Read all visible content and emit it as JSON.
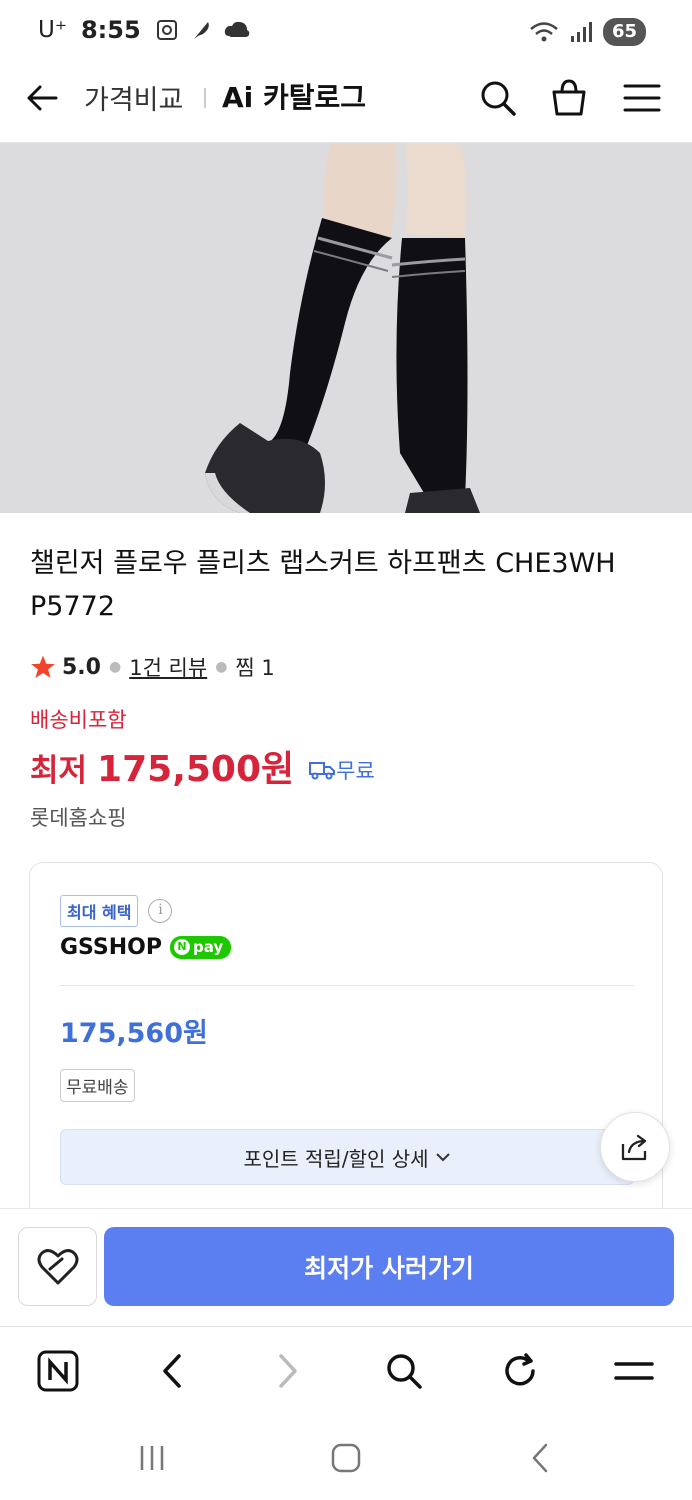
{
  "status_bar": {
    "carrier": "U⁺",
    "time": "8:55",
    "battery": "65"
  },
  "header": {
    "subtitle": "가격비교",
    "title": "Ai 카탈로그"
  },
  "product": {
    "title": "챌린저 플로우 플리츠 랩스커트 하프팬츠 CHE3WH P5772",
    "rating": "5.0",
    "reviews": "1건 리뷰",
    "wish": "찜 1",
    "shipping_note": "배송비포함",
    "price_label": "최저",
    "price": "175,500원",
    "free_shipping": "무료",
    "seller": "롯데홈쇼핑"
  },
  "offer": {
    "benefit_badge": "최대 혜택",
    "shop_name": "GSSHOP",
    "npay_label": "pay",
    "price": "175,560원",
    "shipping_tag": "무료배송",
    "point_detail": "포인트 적립/할인 상세"
  },
  "actions": {
    "buy_label": "최저가 사러가기"
  },
  "icons": {
    "star_color": "#f0442c",
    "accent": "#5b7ff0",
    "price_color": "#d6243a"
  }
}
